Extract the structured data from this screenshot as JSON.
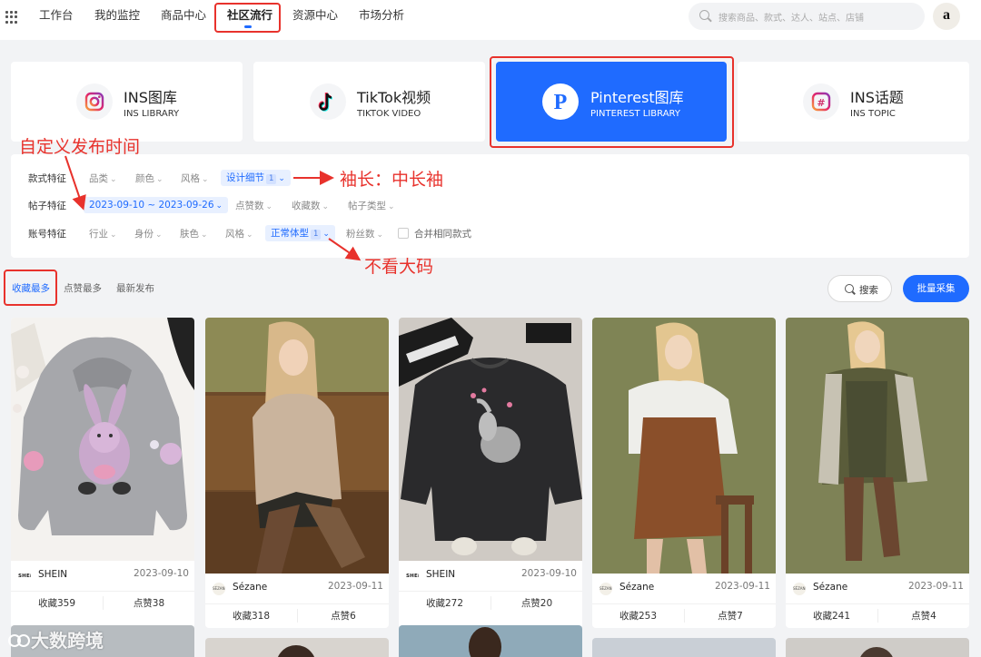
{
  "nav": {
    "items": [
      "工作台",
      "我的监控",
      "商品中心",
      "社区流行",
      "资源中心",
      "市场分析"
    ],
    "active": "社区流行",
    "search_placeholder": "搜索商品、款式、达人、站点、店铺",
    "avatar_letter": "a"
  },
  "libraries": [
    {
      "title": "INS图库",
      "subtitle": "INS LIBRARY",
      "icon": "instagram-icon"
    },
    {
      "title": "TikTok视频",
      "subtitle": "TIKTOK VIDEO",
      "icon": "tiktok-icon"
    },
    {
      "title": "Pinterest图库",
      "subtitle": "PINTEREST LIBRARY",
      "icon": "pinterest-icon"
    },
    {
      "title": "INS话题",
      "subtitle": "INS TOPIC",
      "icon": "hashtag-icon"
    }
  ],
  "annotations": {
    "custom_publish_time": "自定义发布时间",
    "sleeve": "袖长：中长袖",
    "no_plus_size": "不看大码"
  },
  "filters": {
    "style": {
      "label": "款式特征",
      "options": [
        "品类",
        "颜色",
        "风格"
      ],
      "chip": "设计细节",
      "chip_count": "1"
    },
    "post": {
      "label": "帖子特征",
      "chip": "2023-09-10 ~ 2023-09-26",
      "options": [
        "点赞数",
        "收藏数",
        "帖子类型"
      ]
    },
    "account": {
      "label": "账号特征",
      "options": [
        "行业",
        "身份",
        "肤色",
        "风格"
      ],
      "chip": "正常体型",
      "chip_count": "1",
      "options_after": [
        "粉丝数"
      ],
      "merge_label": "合并相同款式"
    }
  },
  "sort": {
    "tabs": [
      "收藏最多",
      "点赞最多",
      "最新发布"
    ],
    "active": "收藏最多"
  },
  "buttons": {
    "search": "搜索",
    "batch": "批量采集"
  },
  "cards": [
    {
      "brand": "SHEIN",
      "logo": "SHEIN",
      "date": "2023-09-10",
      "favorites": "收藏359",
      "likes": "点赞38"
    },
    {
      "brand": "Sézane",
      "logo": "SÉZANE",
      "date": "2023-09-11",
      "favorites": "收藏318",
      "likes": "点赞6"
    },
    {
      "brand": "SHEIN",
      "logo": "SHEIN",
      "date": "2023-09-10",
      "favorites": "收藏272",
      "likes": "点赞20"
    },
    {
      "brand": "Sézane",
      "logo": "SÉZANE",
      "date": "2023-09-11",
      "favorites": "收藏253",
      "likes": "点赞7"
    },
    {
      "brand": "Sézane",
      "logo": "SÉZANE",
      "date": "2023-09-11",
      "favorites": "收藏241",
      "likes": "点赞4"
    }
  ],
  "watermark": "大数跨境",
  "colors": {
    "accent": "#1f6bff",
    "annotation_red": "#e8322c"
  }
}
